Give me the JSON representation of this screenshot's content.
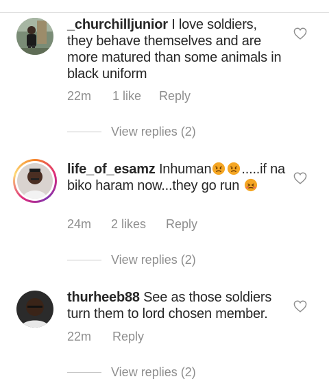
{
  "comments": [
    {
      "username": "_churchilljunior",
      "text": "I love soldiers, they behave themselves and are more matured than some animals in black uniform",
      "time": "22m",
      "likes": "1 like",
      "reply": "Reply",
      "view_replies": "View replies (2)",
      "has_story_ring": false
    },
    {
      "username": "life_of_esamz",
      "text_before": "Inhuman",
      "text_after": ".....if na biko haram now...they go run",
      "time": "24m",
      "likes": "2 likes",
      "reply": "Reply",
      "view_replies": "View replies (2)",
      "has_story_ring": true,
      "emojis": [
        "angry-face",
        "angry-face",
        "persevering-face"
      ]
    },
    {
      "username": "thurheeb88",
      "text": "See as those soldiers turn them to lord chosen member.",
      "time": "22m",
      "likes": "",
      "reply": "Reply",
      "view_replies": "View replies (2)",
      "has_story_ring": false
    }
  ],
  "colors": {
    "text": "#262626",
    "muted": "#8e8e8e",
    "divider": "#c7c7c7",
    "emoji": "#f5a623"
  },
  "icons": {
    "like": "heart-outline-icon"
  }
}
